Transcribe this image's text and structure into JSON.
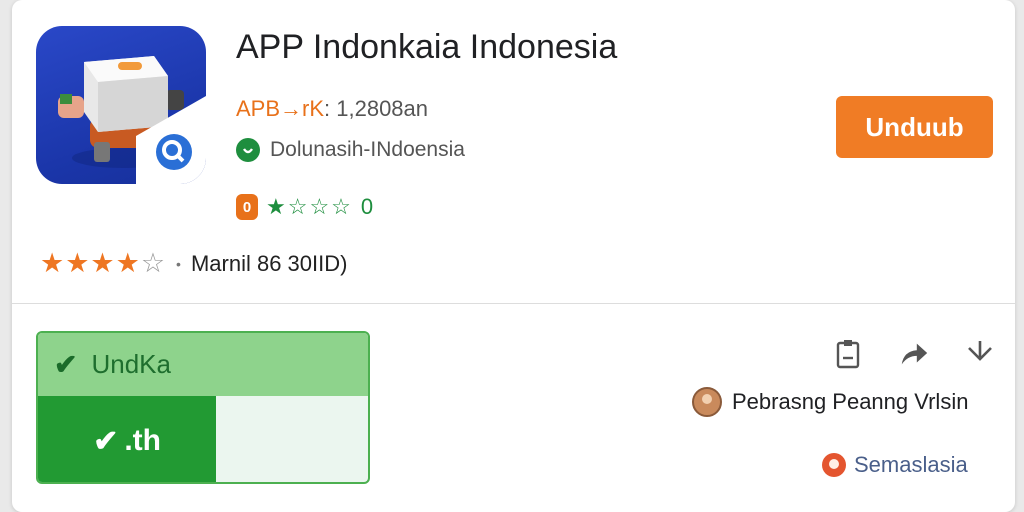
{
  "app": {
    "title": "APP Indonkaia  Indonesia",
    "meta_accent": "APB→rK",
    "meta_rest": ": 1,2808an",
    "developer": "Dolunasih-INdoensia",
    "badge": "0",
    "rating_stars_green": "★☆☆☆",
    "rating_count": "0",
    "rating_stars_orange_filled": "★★★★",
    "rating_stars_orange_empty": "☆",
    "rating_text": "Marnil 86 30IID)"
  },
  "install": {
    "label": "Unduub"
  },
  "progress": {
    "head_label": "UndKa",
    "fill_label": ".th",
    "fill_fraction": 0.54
  },
  "actions": {
    "icons": [
      "report-icon",
      "share-icon",
      "download-icon"
    ]
  },
  "user": {
    "name": "Pebrasng Peanng Vrlsin"
  },
  "region": {
    "name": "Semaslasia"
  },
  "colors": {
    "accent_orange": "#f07c25",
    "green": "#1e8e3e",
    "progress_fill": "#229a33",
    "progress_head": "#8ed38c"
  }
}
